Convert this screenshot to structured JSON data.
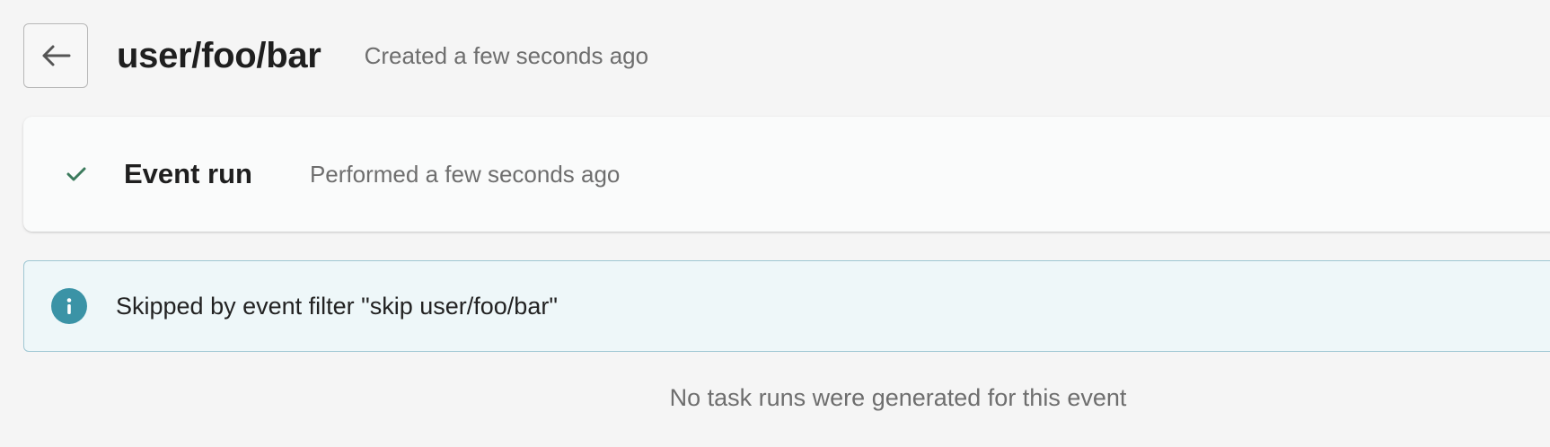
{
  "header": {
    "back_icon": "arrow-left-icon",
    "title": "user/foo/bar",
    "created": "Created a few seconds ago"
  },
  "event_run": {
    "status_icon": "check-icon",
    "status_color": "#3b7a5c",
    "title": "Event run",
    "performed": "Performed a few seconds ago"
  },
  "info_banner": {
    "icon": "info-icon",
    "accent_color": "#3b93a6",
    "message": "Skipped by event filter \"skip user/foo/bar\""
  },
  "task_runs": {
    "empty_message": "No task runs were generated for this event"
  }
}
